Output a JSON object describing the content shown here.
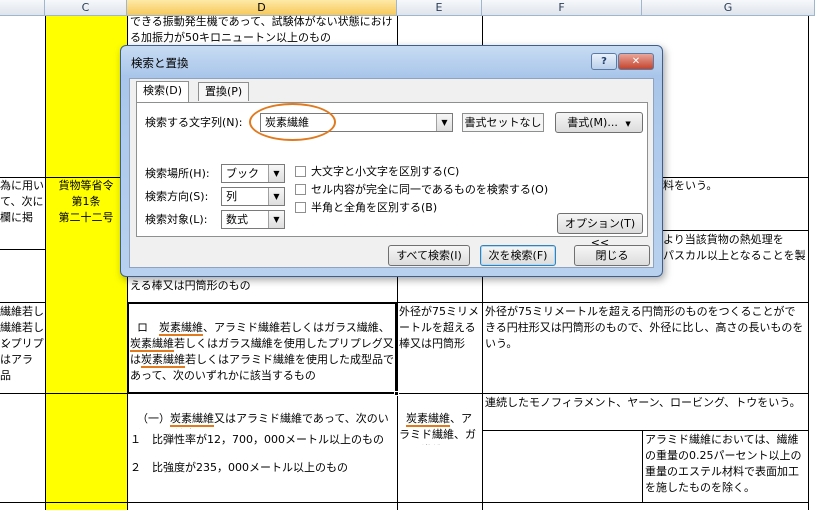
{
  "columns": {
    "C": "C",
    "D": "D",
    "E": "E",
    "F": "F",
    "G": "G"
  },
  "sheet": {
    "row_top_d": "できる振動発生機であって、試験体がない状態における加振力が50キロニュートン以上のもの",
    "b_left_1": "為に用い",
    "b_left_2": "て、次に",
    "b_left_3": "欄に掲",
    "c_law_1": "貨物等省令",
    "c_law_2": "第1条",
    "c_law_3": "第二十二号",
    "f_row_b": "料をいう。",
    "f_row_c_1": "より当該貨物の熱処理を",
    "f_row_c_2": "パスカル以上となることを製",
    "d_row_c": "える棒又は円筒形のもの",
    "b_left_4": "繊維若し",
    "b_left_5": "繊維若しく",
    "b_left_6": "ンプリプ",
    "b_left_7": "はアラ",
    "b_left_8": "品",
    "d_sel_pre": "ロ　",
    "d_sel_hit1": "炭素繊維",
    "d_sel_mid1": "、アラミド繊維若しくはガラス繊維、",
    "d_sel_hit2": "炭素繊維",
    "d_sel_mid2": "若しくはガラス繊維を使用したプリプレグ又は",
    "d_sel_hit3": "炭素繊維",
    "d_sel_rest": "若しくはアラミド繊維を使用した成型品であって、次のいずれかに該当するもの",
    "e_sel": "外径が75ミリメートルを超える棒又は円筒形",
    "f_sel": "外径が75ミリメートルを超える円筒形のものをつくることができる円柱形又は円筒形のもので、外径に比し、高さの長いものをいう。",
    "d_ichi_pre": "（一）",
    "d_ichi_hit": "炭素繊維",
    "d_ichi_rest": "又はアラミド繊維であって、次のいずれかに該当するもの",
    "d_item1": "１　比弾性率が12，700，000メートル以上のもの",
    "d_item2": "２　比強度が235，000メートル以上のもの",
    "e_ichi_hit": "炭素繊維",
    "e_ichi_rest": "、アラミド繊維、ガラス繊維",
    "f_ichi": "連続したモノフィラメント、ヤーン、ロービング、トウをいう。",
    "g_note": "アラミド繊維においては、繊維の重量の0.25パーセント以上の重量のエステル材料で表面加工を施したものを除く。"
  },
  "dialog": {
    "title": "検索と置換",
    "help": "?",
    "close": "✕",
    "tab_search": "検索(D)",
    "tab_replace": "置換(P)",
    "find_label": "検索する文字列(N):",
    "find_value": "炭素繊維",
    "format_status": "書式セットなし",
    "format_btn": "書式(M)...",
    "within_label": "検索場所(H):",
    "within_value": "ブック",
    "direction_label": "検索方向(S):",
    "direction_value": "列",
    "lookin_label": "検索対象(L):",
    "lookin_value": "数式",
    "opt_case": "大文字と小文字を区別する(C)",
    "opt_whole": "セル内容が完全に同一であるものを検索する(O)",
    "opt_width": "半角と全角を区別する(B)",
    "options_btn": "オプション(T) <<",
    "find_all": "すべて検索(I)",
    "find_next": "次を検索(F)",
    "close_btn": "閉じる"
  },
  "colors": {
    "highlight_ring": "#e07a1f",
    "law_column": "#ffff00"
  }
}
